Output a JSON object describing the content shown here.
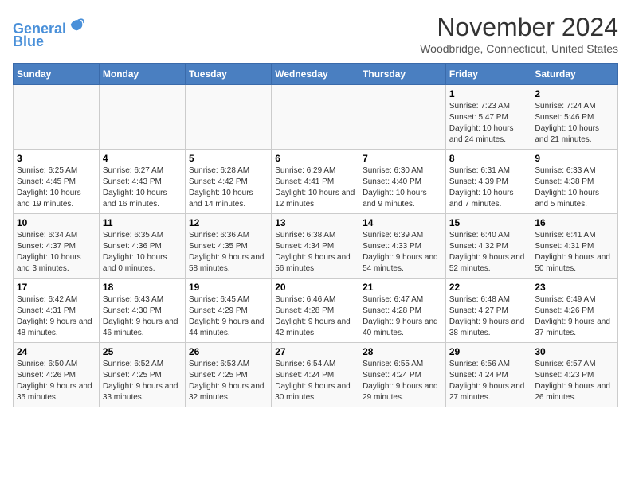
{
  "header": {
    "logo_line1": "General",
    "logo_line2": "Blue",
    "main_title": "November 2024",
    "subtitle": "Woodbridge, Connecticut, United States"
  },
  "weekdays": [
    "Sunday",
    "Monday",
    "Tuesday",
    "Wednesday",
    "Thursday",
    "Friday",
    "Saturday"
  ],
  "weeks": [
    [
      {
        "day": "",
        "sunrise": "",
        "sunset": "",
        "daylight": ""
      },
      {
        "day": "",
        "sunrise": "",
        "sunset": "",
        "daylight": ""
      },
      {
        "day": "",
        "sunrise": "",
        "sunset": "",
        "daylight": ""
      },
      {
        "day": "",
        "sunrise": "",
        "sunset": "",
        "daylight": ""
      },
      {
        "day": "",
        "sunrise": "",
        "sunset": "",
        "daylight": ""
      },
      {
        "day": "1",
        "sunrise": "Sunrise: 7:23 AM",
        "sunset": "Sunset: 5:47 PM",
        "daylight": "Daylight: 10 hours and 24 minutes."
      },
      {
        "day": "2",
        "sunrise": "Sunrise: 7:24 AM",
        "sunset": "Sunset: 5:46 PM",
        "daylight": "Daylight: 10 hours and 21 minutes."
      }
    ],
    [
      {
        "day": "3",
        "sunrise": "Sunrise: 6:25 AM",
        "sunset": "Sunset: 4:45 PM",
        "daylight": "Daylight: 10 hours and 19 minutes."
      },
      {
        "day": "4",
        "sunrise": "Sunrise: 6:27 AM",
        "sunset": "Sunset: 4:43 PM",
        "daylight": "Daylight: 10 hours and 16 minutes."
      },
      {
        "day": "5",
        "sunrise": "Sunrise: 6:28 AM",
        "sunset": "Sunset: 4:42 PM",
        "daylight": "Daylight: 10 hours and 14 minutes."
      },
      {
        "day": "6",
        "sunrise": "Sunrise: 6:29 AM",
        "sunset": "Sunset: 4:41 PM",
        "daylight": "Daylight: 10 hours and 12 minutes."
      },
      {
        "day": "7",
        "sunrise": "Sunrise: 6:30 AM",
        "sunset": "Sunset: 4:40 PM",
        "daylight": "Daylight: 10 hours and 9 minutes."
      },
      {
        "day": "8",
        "sunrise": "Sunrise: 6:31 AM",
        "sunset": "Sunset: 4:39 PM",
        "daylight": "Daylight: 10 hours and 7 minutes."
      },
      {
        "day": "9",
        "sunrise": "Sunrise: 6:33 AM",
        "sunset": "Sunset: 4:38 PM",
        "daylight": "Daylight: 10 hours and 5 minutes."
      }
    ],
    [
      {
        "day": "10",
        "sunrise": "Sunrise: 6:34 AM",
        "sunset": "Sunset: 4:37 PM",
        "daylight": "Daylight: 10 hours and 3 minutes."
      },
      {
        "day": "11",
        "sunrise": "Sunrise: 6:35 AM",
        "sunset": "Sunset: 4:36 PM",
        "daylight": "Daylight: 10 hours and 0 minutes."
      },
      {
        "day": "12",
        "sunrise": "Sunrise: 6:36 AM",
        "sunset": "Sunset: 4:35 PM",
        "daylight": "Daylight: 9 hours and 58 minutes."
      },
      {
        "day": "13",
        "sunrise": "Sunrise: 6:38 AM",
        "sunset": "Sunset: 4:34 PM",
        "daylight": "Daylight: 9 hours and 56 minutes."
      },
      {
        "day": "14",
        "sunrise": "Sunrise: 6:39 AM",
        "sunset": "Sunset: 4:33 PM",
        "daylight": "Daylight: 9 hours and 54 minutes."
      },
      {
        "day": "15",
        "sunrise": "Sunrise: 6:40 AM",
        "sunset": "Sunset: 4:32 PM",
        "daylight": "Daylight: 9 hours and 52 minutes."
      },
      {
        "day": "16",
        "sunrise": "Sunrise: 6:41 AM",
        "sunset": "Sunset: 4:31 PM",
        "daylight": "Daylight: 9 hours and 50 minutes."
      }
    ],
    [
      {
        "day": "17",
        "sunrise": "Sunrise: 6:42 AM",
        "sunset": "Sunset: 4:31 PM",
        "daylight": "Daylight: 9 hours and 48 minutes."
      },
      {
        "day": "18",
        "sunrise": "Sunrise: 6:43 AM",
        "sunset": "Sunset: 4:30 PM",
        "daylight": "Daylight: 9 hours and 46 minutes."
      },
      {
        "day": "19",
        "sunrise": "Sunrise: 6:45 AM",
        "sunset": "Sunset: 4:29 PM",
        "daylight": "Daylight: 9 hours and 44 minutes."
      },
      {
        "day": "20",
        "sunrise": "Sunrise: 6:46 AM",
        "sunset": "Sunset: 4:28 PM",
        "daylight": "Daylight: 9 hours and 42 minutes."
      },
      {
        "day": "21",
        "sunrise": "Sunrise: 6:47 AM",
        "sunset": "Sunset: 4:28 PM",
        "daylight": "Daylight: 9 hours and 40 minutes."
      },
      {
        "day": "22",
        "sunrise": "Sunrise: 6:48 AM",
        "sunset": "Sunset: 4:27 PM",
        "daylight": "Daylight: 9 hours and 38 minutes."
      },
      {
        "day": "23",
        "sunrise": "Sunrise: 6:49 AM",
        "sunset": "Sunset: 4:26 PM",
        "daylight": "Daylight: 9 hours and 37 minutes."
      }
    ],
    [
      {
        "day": "24",
        "sunrise": "Sunrise: 6:50 AM",
        "sunset": "Sunset: 4:26 PM",
        "daylight": "Daylight: 9 hours and 35 minutes."
      },
      {
        "day": "25",
        "sunrise": "Sunrise: 6:52 AM",
        "sunset": "Sunset: 4:25 PM",
        "daylight": "Daylight: 9 hours and 33 minutes."
      },
      {
        "day": "26",
        "sunrise": "Sunrise: 6:53 AM",
        "sunset": "Sunset: 4:25 PM",
        "daylight": "Daylight: 9 hours and 32 minutes."
      },
      {
        "day": "27",
        "sunrise": "Sunrise: 6:54 AM",
        "sunset": "Sunset: 4:24 PM",
        "daylight": "Daylight: 9 hours and 30 minutes."
      },
      {
        "day": "28",
        "sunrise": "Sunrise: 6:55 AM",
        "sunset": "Sunset: 4:24 PM",
        "daylight": "Daylight: 9 hours and 29 minutes."
      },
      {
        "day": "29",
        "sunrise": "Sunrise: 6:56 AM",
        "sunset": "Sunset: 4:24 PM",
        "daylight": "Daylight: 9 hours and 27 minutes."
      },
      {
        "day": "30",
        "sunrise": "Sunrise: 6:57 AM",
        "sunset": "Sunset: 4:23 PM",
        "daylight": "Daylight: 9 hours and 26 minutes."
      }
    ]
  ]
}
